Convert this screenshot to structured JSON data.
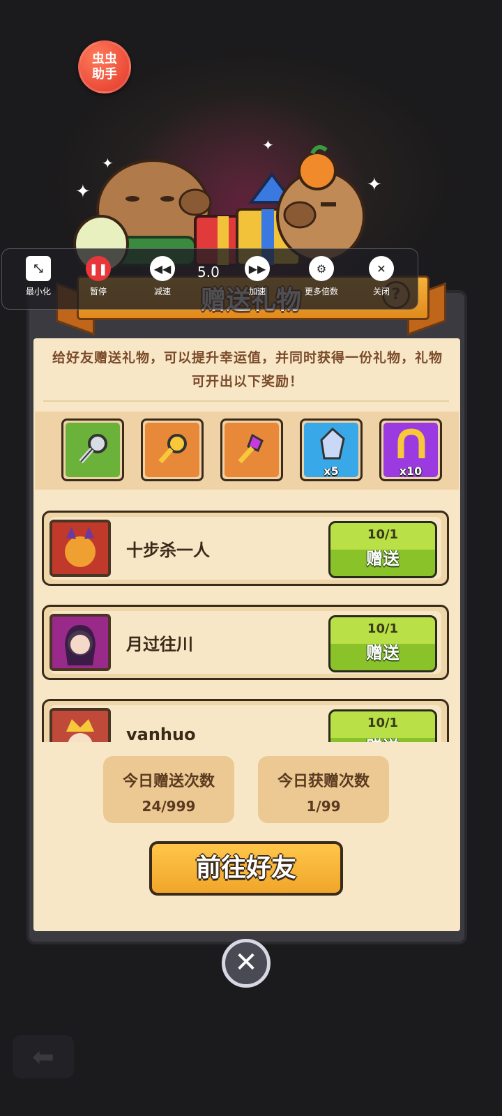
{
  "helper": {
    "line1": "虫虫",
    "line2": "助手"
  },
  "toolbar": {
    "speed_value": "5.0",
    "items": [
      {
        "label": "最小化",
        "icon": "minimize-icon"
      },
      {
        "label": "暂停",
        "icon": "pause-icon"
      },
      {
        "label": "减速",
        "icon": "rewind-icon"
      },
      {
        "label": "加速",
        "icon": "fast-forward-icon"
      },
      {
        "label": "更多倍数",
        "icon": "gear-icon"
      },
      {
        "label": "关闭",
        "icon": "close-icon"
      }
    ]
  },
  "dialog": {
    "title": "赠送礼物",
    "help": "?",
    "description": "给好友赠送礼物，可以提升幸运值，并同时获得一份礼物，礼物可开出以下奖励！",
    "rewards": [
      {
        "icon": "silver-key-icon",
        "color": "#6bb23a",
        "count": ""
      },
      {
        "icon": "gold-key-icon",
        "color": "#e8893a",
        "count": ""
      },
      {
        "icon": "gem-key-icon",
        "color": "#e8893a",
        "count": ""
      },
      {
        "icon": "crystal-icon",
        "color": "#39a8e8",
        "count": "x5"
      },
      {
        "icon": "horseshoe-icon",
        "color": "#9a3ae0",
        "count": "x10"
      }
    ],
    "friends": [
      {
        "name": "十步杀一人",
        "count": "10/1",
        "action": "赠送"
      },
      {
        "name": "月过往川",
        "count": "10/1",
        "action": "赠送"
      },
      {
        "name": "vanhuo",
        "count": "10/1",
        "action": "赠送"
      }
    ],
    "stats": {
      "sent_title": "今日赠送次数",
      "sent_value": "24/999",
      "received_title": "今日获赠次数",
      "received_value": "1/99"
    },
    "goto_label": "前往好友"
  }
}
